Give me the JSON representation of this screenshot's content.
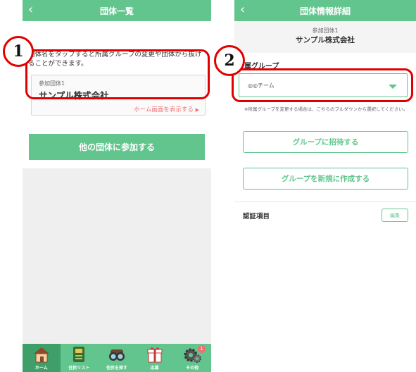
{
  "left": {
    "header_title": "団体一覧",
    "instruction": "団体名をタップすると所属グループの変更や団体から抜けることができます。",
    "card_label": "参加団体1",
    "card_name": "サンプル株式会社",
    "card_link": "ホーム画面を表示する",
    "join_button": "他の団体に参加する",
    "tabs": [
      {
        "label": "ホーム",
        "icon": "house-icon",
        "active": true
      },
      {
        "label": "住民リスト",
        "icon": "resident-list-book-icon"
      },
      {
        "label": "住民を探す",
        "icon": "binoculars-icon"
      },
      {
        "label": "応募",
        "icon": "gift-icon"
      },
      {
        "label": "その他",
        "icon": "gear-icon",
        "badge": "1"
      }
    ]
  },
  "right": {
    "header_title": "団体情報詳細",
    "group_small": "参加団体1",
    "group_name": "サンプル株式会社",
    "affiliation_label": "属グループ",
    "select_value": "◎◎チーム",
    "note": "※所属グループを変更する場合は、こちらのプルダウンから選択してください。",
    "invite_button": "グループに招待する",
    "create_button": "グループを新規に作成する",
    "auth_label": "認証項目",
    "edit_button": "編集"
  },
  "callouts": [
    "1",
    "2"
  ],
  "colors": {
    "green": "#62c58e",
    "red": "#e00000",
    "pink": "#ef6f6f"
  }
}
